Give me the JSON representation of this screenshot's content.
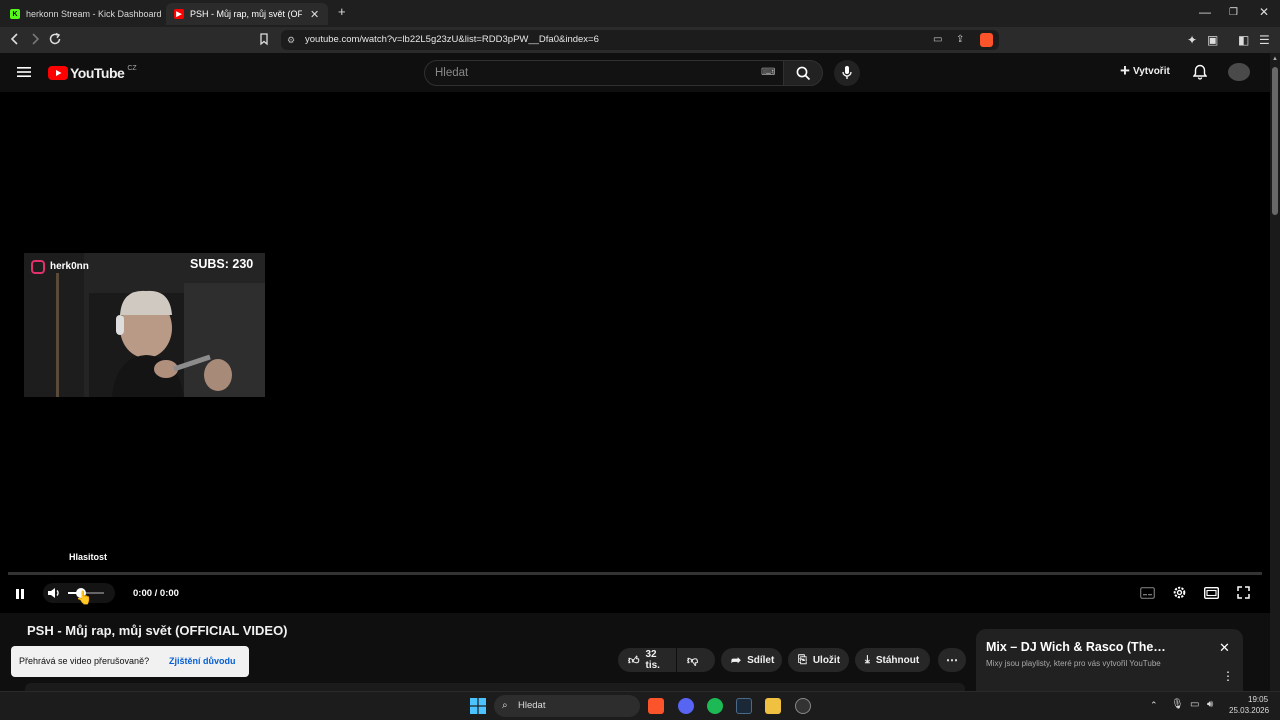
{
  "browser": {
    "tabs": [
      {
        "title": "herkonn Stream - Kick Dashboard"
      },
      {
        "title": "PSH - Můj rap, můj svět (OFFICIA"
      }
    ],
    "new_tab_symbol": "+",
    "url": "youtube.com/watch?v=lb22L5g23zU&list=RDD3pPW__Dfa0&index=6",
    "window_controls": [
      "—",
      "❐",
      "✕"
    ]
  },
  "youtube": {
    "logo_text": "YouTube",
    "country": "CZ",
    "search_placeholder": "Hledat",
    "create_label": "Vytvořit"
  },
  "player": {
    "overlay": {
      "handle": "herk0nn",
      "subs": "SUBS: 230"
    },
    "volume_tooltip": "Hlasitost",
    "time": "0:00 / 0:00",
    "progress": 0,
    "volume": 0.35
  },
  "video": {
    "title": "PSH - Můj rap, můj svět (OFFICIAL VIDEO)",
    "like_count": "32 tis.",
    "share_label": "Sdílet",
    "save_label": "Uložit",
    "download_label": "Stáhnout"
  },
  "interrupt_toast": {
    "question": "Přehrává se video přerušovaně?",
    "link": "Zjištění důvodu"
  },
  "mix_panel": {
    "title": "Mix – DJ Wich & Rasco (The…",
    "subtitle": "Mixy jsou playlisty, které pro vás vytvořil YouTube"
  },
  "taskbar": {
    "search_label": "Hledat",
    "time": "19:05",
    "date": "25.03.2026"
  },
  "colors": {
    "youtube_red": "#ff0000",
    "link_blue": "#065fd4",
    "kick_green": "#53fc18"
  }
}
